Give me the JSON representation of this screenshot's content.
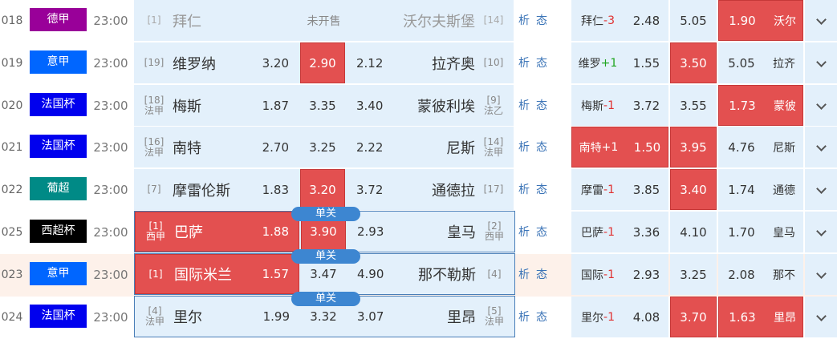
{
  "analysis_labels": [
    "析",
    "态"
  ],
  "tag_label": "单关",
  "colors": {
    "selected": "#e35050",
    "panel": "#e3f0fb",
    "link": "#3b74b7"
  },
  "rows": [
    {
      "num": "018",
      "league": "德甲",
      "league_color": "#990099",
      "time": "23:00",
      "status": "未开售",
      "home": {
        "rank": [
          "[1]"
        ],
        "name": "拜仁"
      },
      "away": {
        "rank": [
          "[14]"
        ],
        "name": "沃尔夫斯堡"
      },
      "hc_name": "拜仁",
      "hc_value": "-3",
      "hc_odds": [
        "2.48",
        "5.05",
        "1.90"
      ],
      "hc_sel": 2,
      "hc_away": "沃尔"
    },
    {
      "num": "019",
      "league": "意甲",
      "league_color": "#0066ff",
      "time": "23:00",
      "home": {
        "rank": [
          "[19]"
        ],
        "name": "维罗纳",
        "odds": "3.20"
      },
      "draw": "2.90",
      "away": {
        "rank": [
          "[10]"
        ],
        "name": "拉齐奥",
        "odds": "2.12"
      },
      "sel": 1,
      "hc_name": "维罗",
      "hc_value": "+1",
      "hc_odds": [
        "1.55",
        "3.50",
        "5.05"
      ],
      "hc_sel": 1,
      "hc_away": "拉齐"
    },
    {
      "num": "020",
      "league": "法国杯",
      "league_color": "#0000ee",
      "time": "23:00",
      "home": {
        "rank": [
          "[18]",
          "法甲"
        ],
        "name": "梅斯",
        "odds": "1.87"
      },
      "draw": "3.35",
      "away": {
        "rank": [
          "[9]",
          "法乙"
        ],
        "name": "蒙彼利埃",
        "odds": "3.40"
      },
      "sel": -1,
      "hc_name": "梅斯",
      "hc_value": "-1",
      "hc_odds": [
        "3.72",
        "3.55",
        "1.73"
      ],
      "hc_sel": 2,
      "hc_away": "蒙彼"
    },
    {
      "num": "021",
      "league": "法国杯",
      "league_color": "#0000ee",
      "time": "23:00",
      "home": {
        "rank": [
          "[16]",
          "法甲"
        ],
        "name": "南特",
        "odds": "2.70"
      },
      "draw": "3.25",
      "away": {
        "rank": [
          "[14]",
          "法甲"
        ],
        "name": "尼斯",
        "odds": "2.22"
      },
      "sel": -1,
      "hc_name": "南特",
      "hc_value": "+1",
      "hc_odds": [
        "1.50",
        "3.95",
        "4.76"
      ],
      "hc_sel": [
        0,
        1
      ],
      "hc_away": "尼斯"
    },
    {
      "num": "022",
      "league": "葡超",
      "league_color": "#008a86",
      "time": "23:00",
      "home": {
        "rank": [
          "[7]"
        ],
        "name": "摩雷伦斯",
        "odds": "1.83"
      },
      "draw": "3.20",
      "away": {
        "rank": [
          "[17]"
        ],
        "name": "通德拉",
        "odds": "3.72"
      },
      "sel": 1,
      "hc_name": "摩雷",
      "hc_value": "-1",
      "hc_odds": [
        "3.85",
        "3.40",
        "1.74"
      ],
      "hc_sel": 1,
      "hc_away": "通德"
    },
    {
      "num": "025",
      "league": "西超杯",
      "league_color": "#000000",
      "time": "23:00",
      "hot": true,
      "home": {
        "rank": [
          "[1]",
          "西甲"
        ],
        "name": "巴萨",
        "odds": "1.88"
      },
      "draw": "3.90",
      "away": {
        "rank": [
          "[2]",
          "西甲"
        ],
        "name": "皇马",
        "odds": "2.93"
      },
      "sel": [
        0,
        1
      ],
      "hc_name": "巴萨",
      "hc_value": "-1",
      "hc_odds": [
        "3.36",
        "4.10",
        "1.70"
      ],
      "hc_sel": -1,
      "hc_away": "皇马"
    },
    {
      "num": "023",
      "league": "意甲",
      "league_color": "#0066ff",
      "time": "23:00",
      "hot": true,
      "highlight": true,
      "home": {
        "rank": [
          "[1]"
        ],
        "name": "国际米兰",
        "odds": "1.57"
      },
      "draw": "3.47",
      "away": {
        "rank": [
          "[4]"
        ],
        "name": "那不勒斯",
        "odds": "4.90"
      },
      "sel": 0,
      "hc_name": "国际",
      "hc_value": "-1",
      "hc_odds": [
        "2.93",
        "3.25",
        "2.08"
      ],
      "hc_sel": -1,
      "hc_away": "那不"
    },
    {
      "num": "024",
      "league": "法国杯",
      "league_color": "#0000ee",
      "time": "23:00",
      "hot": true,
      "home": {
        "rank": [
          "[4]",
          "法甲"
        ],
        "name": "里尔",
        "odds": "1.99"
      },
      "draw": "3.32",
      "away": {
        "rank": [
          "[5]",
          "法甲"
        ],
        "name": "里昂",
        "odds": "3.07"
      },
      "sel": -1,
      "hc_name": "里尔",
      "hc_value": "-1",
      "hc_odds": [
        "4.08",
        "3.70",
        "1.63"
      ],
      "hc_sel": [
        1,
        2
      ],
      "hc_away": "里昂"
    }
  ]
}
